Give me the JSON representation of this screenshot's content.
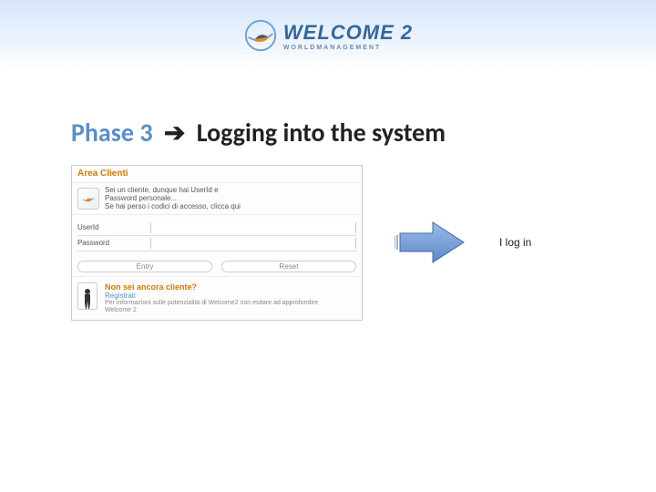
{
  "logo": {
    "line1": "WELCOME 2",
    "line2": "WORLDMANAGEMENT"
  },
  "title": {
    "phase": "Phase 3",
    "rest": "Logging into the system"
  },
  "login_panel": {
    "title": "Area Clienti",
    "desc1": "Sei un cliente, dunque hai UserId e",
    "desc2": "Password personale...",
    "desc3": "Se hai perso i codici di accesso, clicca qui",
    "user_label": "UserId",
    "password_label": "Password",
    "userid_value": "",
    "password_value": "",
    "btn_entry": "Entry",
    "btn_reset": "Reset",
    "register_q": "Non sei ancora cliente?",
    "register_link": "Registrati",
    "register_desc1": "Per informazioni sulle potenzialità di Welcome2 non esitare ad approfondire",
    "register_desc2": "Welcome 2"
  },
  "annotation": "I log in"
}
